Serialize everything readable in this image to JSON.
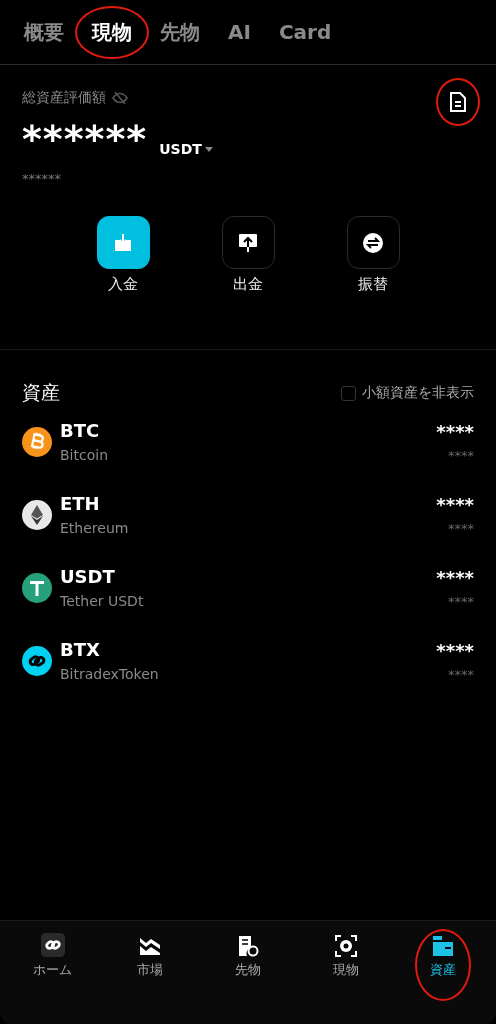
{
  "tabs": [
    {
      "label": "概要",
      "selected": false,
      "circled": false
    },
    {
      "label": "現物",
      "selected": true,
      "circled": true
    },
    {
      "label": "先物",
      "selected": false,
      "circled": false
    },
    {
      "label": "AI",
      "selected": false,
      "circled": false
    },
    {
      "label": "Card",
      "selected": false,
      "circled": false
    }
  ],
  "summary": {
    "label": "総資産評価額",
    "history_circled": true,
    "amount": "******",
    "currency": "USDT",
    "sub_amount": "******"
  },
  "actions": [
    {
      "kind": "deposit",
      "label": "入金",
      "selected": true
    },
    {
      "kind": "withdraw",
      "label": "出金",
      "selected": false
    },
    {
      "kind": "transfer",
      "label": "振替",
      "selected": false
    }
  ],
  "assets": {
    "title": "資産",
    "hide_small": {
      "label": "小額資産を非表示",
      "checked": false
    },
    "rows": [
      {
        "kind": "btc",
        "symbol": "BTC",
        "name": "Bitcoin",
        "color": "#f7931a",
        "amount": "****",
        "value": "****"
      },
      {
        "kind": "eth",
        "symbol": "ETH",
        "name": "Ethereum",
        "color": "#e8e8e8",
        "amount": "****",
        "value": "****"
      },
      {
        "kind": "usdt",
        "symbol": "USDT",
        "name": "Tether USDt",
        "color": "#26a17b",
        "amount": "****",
        "value": "****"
      },
      {
        "kind": "btx",
        "symbol": "BTX",
        "name": "BitradexToken",
        "color": "#00d1f0",
        "amount": "****",
        "value": "****"
      }
    ]
  },
  "bottom_nav": [
    {
      "kind": "home",
      "label": "ホーム",
      "selected": false,
      "circled": false
    },
    {
      "kind": "market",
      "label": "市場",
      "selected": false,
      "circled": false
    },
    {
      "kind": "futures",
      "label": "先物",
      "selected": false,
      "circled": false
    },
    {
      "kind": "spot",
      "label": "現物",
      "selected": false,
      "circled": false
    },
    {
      "kind": "assets",
      "label": "資産",
      "selected": true,
      "circled": true
    }
  ]
}
